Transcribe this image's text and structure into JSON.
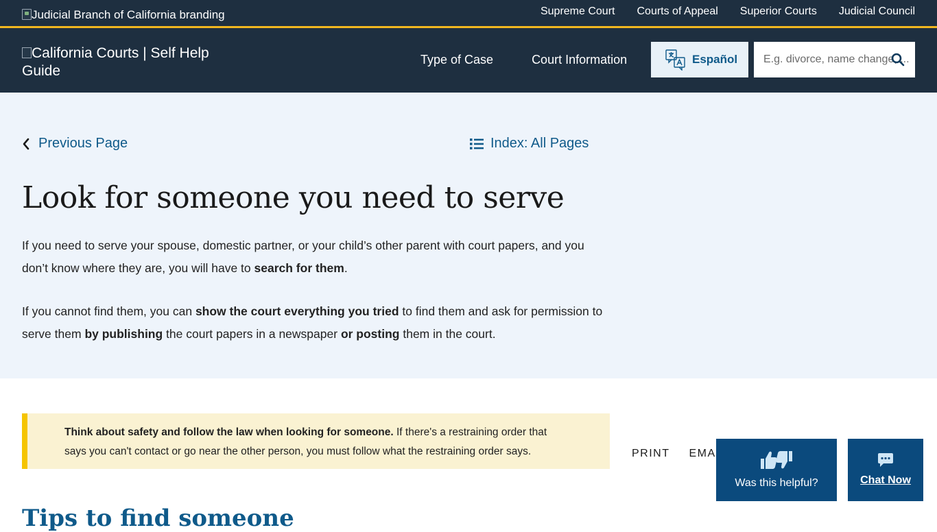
{
  "utility": {
    "branding_alt": "Judicial Branch of California branding",
    "links": [
      "Supreme Court",
      "Courts of Appeal",
      "Superior Courts",
      "Judicial Council"
    ]
  },
  "header": {
    "logo_alt": "California Courts | Self Help Guide",
    "nav": [
      "Type of Case",
      "Court Information"
    ],
    "espanol_label": "Español",
    "search_placeholder": "E.g. divorce, name change, ..."
  },
  "hero": {
    "prev_label": "Previous Page",
    "index_label": "Index: All Pages",
    "title": "Look for someone you need to serve",
    "p1_a": "If you need to serve your spouse, domestic partner, or your child’s other parent with court papers, and you don’t know where they are, you will have to ",
    "p1_b": "search for them",
    "p1_c": ".",
    "p2_a": "If you cannot find them, you can ",
    "p2_b": "show the court everything you tried",
    "p2_c": " to find them and ask for permission to serve them ",
    "p2_d": "by publishing",
    "p2_e": " the court papers in a newspaper ",
    "p2_f": "or posting",
    "p2_g": " them in the court."
  },
  "alert": {
    "bold": "Think about safety and follow the law when looking for someone.",
    "text": " If there's a restraining order that says you can't contact or go near the other person, you must follow what the restraining order says."
  },
  "share": {
    "print": "PRINT",
    "email": "EMAIL"
  },
  "section_title": "Tips to find someone",
  "feedback": {
    "helpful": "Was this helpful?",
    "chat": "Chat Now"
  },
  "colors": {
    "navy": "#1e2f40",
    "gold": "#f2b71f",
    "link": "#0f5a8a",
    "hero_bg": "#eef4fb",
    "alert_bg": "#faf2d2"
  }
}
